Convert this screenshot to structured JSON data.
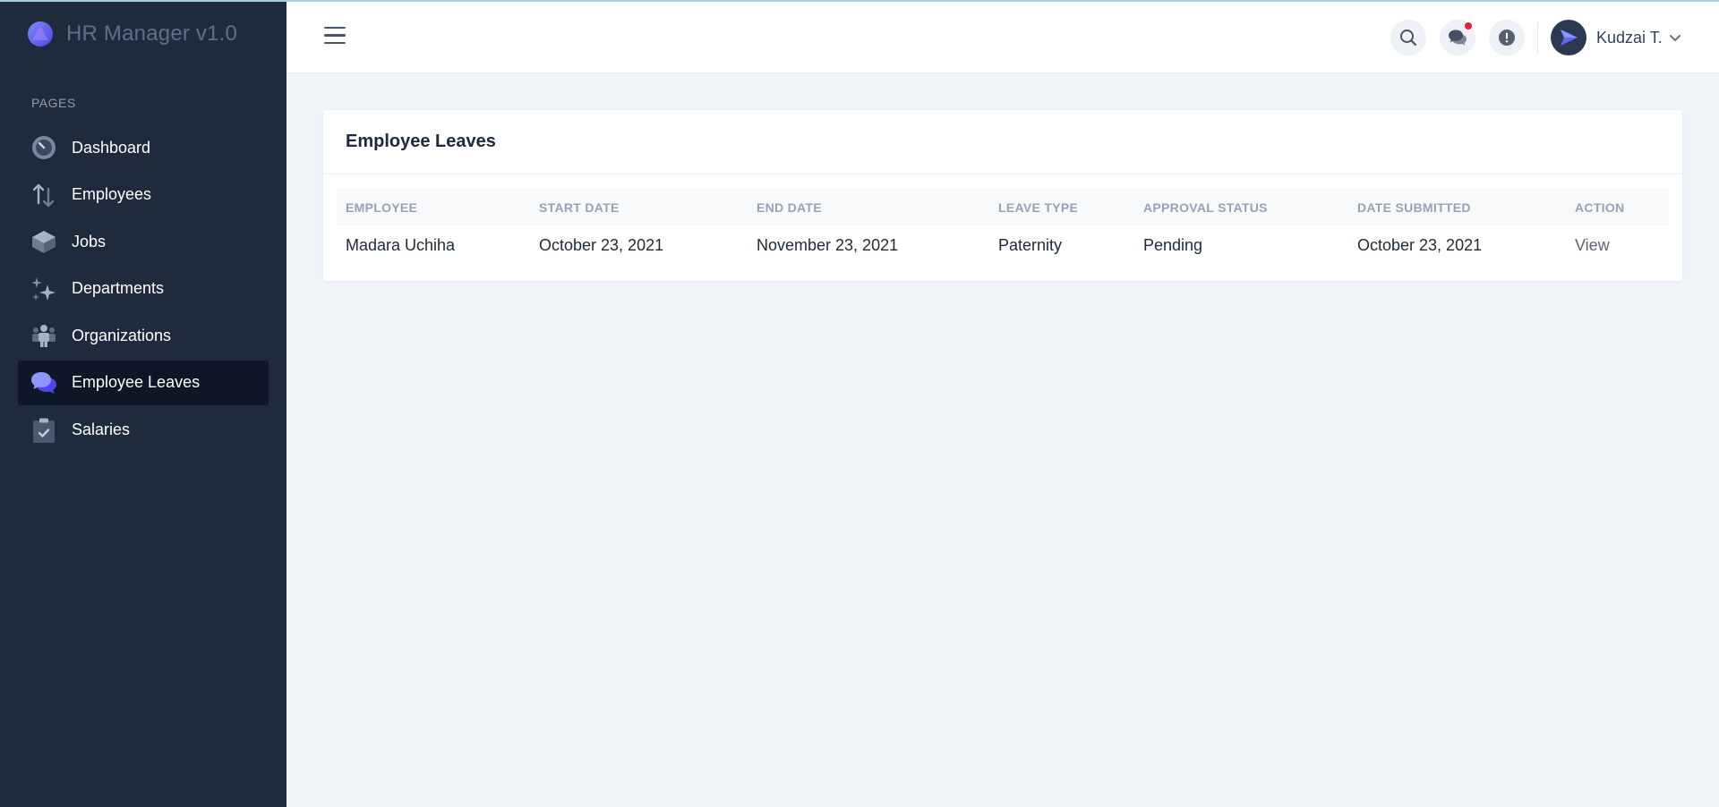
{
  "app": {
    "name": "HR Manager v1.0"
  },
  "sidebar": {
    "section_label": "PAGES",
    "items": [
      {
        "label": "Dashboard",
        "icon": "gauge-icon"
      },
      {
        "label": "Employees",
        "icon": "sort-arrows-icon"
      },
      {
        "label": "Jobs",
        "icon": "box-icon"
      },
      {
        "label": "Departments",
        "icon": "sparkles-icon"
      },
      {
        "label": "Organizations",
        "icon": "people-icon"
      },
      {
        "label": "Employee Leaves",
        "icon": "chat-bubbles-icon",
        "active": true
      },
      {
        "label": "Salaries",
        "icon": "clipboard-check-icon"
      }
    ]
  },
  "header": {
    "user_name": "Kudzai T.",
    "icons": [
      "search-icon",
      "chat-icon",
      "alert-icon"
    ]
  },
  "card": {
    "title": "Employee Leaves",
    "columns": [
      "EMPLOYEE",
      "START DATE",
      "END DATE",
      "LEAVE TYPE",
      "APPROVAL STATUS",
      "DATE SUBMITTED",
      "ACTION"
    ],
    "rows": [
      [
        "Madara Uchiha",
        "October 23, 2021",
        "November 23, 2021",
        "Paternity",
        "Pending",
        "October 23, 2021",
        "View"
      ]
    ]
  },
  "colors": {
    "sidebar_bg": "#1f2a3d",
    "sidebar_active_bg": "#0e1628",
    "accent": "#6366f1",
    "notification": "#e11d48"
  }
}
